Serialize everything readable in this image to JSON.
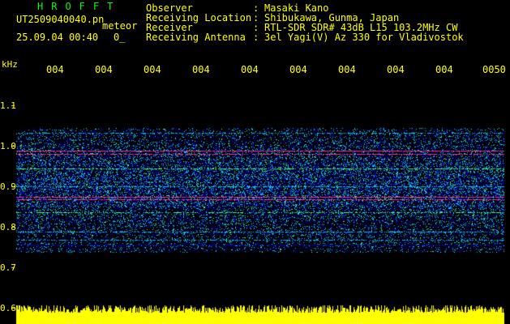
{
  "header": {
    "app_title": "HROFFT",
    "file_name": "UT2509040040.pn",
    "meteor_label": "meteor",
    "date_time": "25.09.04 00:40",
    "count_value": "0_"
  },
  "info": [
    {
      "key": "Observer",
      "sep": ":",
      "value": "Masaki Kano"
    },
    {
      "key": "Receiving Location",
      "sep": ":",
      "value": "Shibukawa, Gunma, Japan"
    },
    {
      "key": "Receiver",
      "sep": ":",
      "value": "RTL-SDR SDR# 43dB L15 103.2MHz CW"
    },
    {
      "key": "Receiving Antenna",
      "sep": ":",
      "value": "3el Yagi(V) Az 330 for Vladivostok"
    }
  ],
  "axes": {
    "y_unit": "kHz",
    "y_ticks": [
      "1.1",
      "1.0",
      "0.9",
      "0.8",
      "0.7",
      "0.6"
    ],
    "x_ticks": [
      "004",
      "004",
      "004",
      "004",
      "004",
      "004",
      "004",
      "004",
      "004",
      "0050"
    ]
  },
  "colors": {
    "background": "#000000",
    "text": "#ffff00",
    "title": "#00ff00",
    "noise_low": "#0000a0",
    "noise_mid": "#00c0ff",
    "noise_high": "#40ff80",
    "signal": "#ff3080",
    "level_bars": "#ffff00"
  }
}
